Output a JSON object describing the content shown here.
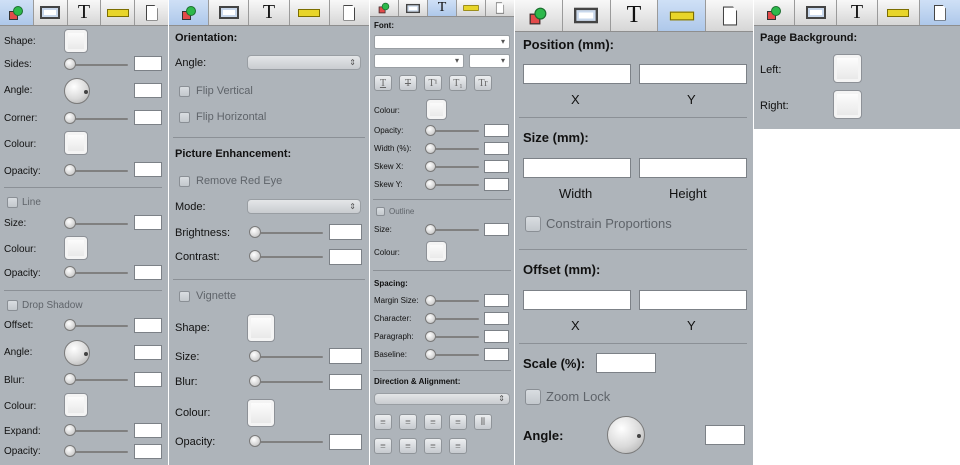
{
  "p1": {
    "tabs": [
      "",
      "",
      "T",
      "",
      ""
    ],
    "shape_label": "Shape:",
    "sides_label": "Sides:",
    "angle_label": "Angle:",
    "corner_label": "Corner:",
    "colour_label": "Colour:",
    "opacity_label": "Opacity:",
    "line_label": "Line",
    "line_size_label": "Size:",
    "line_colour_label": "Colour:",
    "line_opacity_label": "Opacity:",
    "shadow_label": "Drop Shadow",
    "shadow_offset_label": "Offset:",
    "shadow_angle_label": "Angle:",
    "shadow_blur_label": "Blur:",
    "shadow_colour_label": "Colour:",
    "shadow_expand_label": "Expand:",
    "shadow_opacity_label": "Opacity:"
  },
  "p2": {
    "tabs": [
      "",
      "",
      "T",
      "",
      ""
    ],
    "orientation_heading": "Orientation:",
    "angle_label": "Angle:",
    "flip_vertical": "Flip Vertical",
    "flip_horizontal": "Flip Horizontal",
    "enhancement_heading": "Picture Enhancement:",
    "remove_red_eye": "Remove Red Eye",
    "mode_label": "Mode:",
    "brightness_label": "Brightness:",
    "contrast_label": "Contrast:",
    "vignette_label": "Vignette",
    "shape_label": "Shape:",
    "size_label": "Size:",
    "blur_label": "Blur:",
    "colour_label": "Colour:",
    "opacity_label": "Opacity:"
  },
  "p3": {
    "tabs": [
      "",
      "",
      "T",
      "",
      ""
    ],
    "font_heading": "Font:",
    "colour_label": "Colour:",
    "opacity_label": "Opacity:",
    "width_label": "Width (%):",
    "skewx_label": "Skew X:",
    "skewy_label": "Skew Y:",
    "outline_label": "Outline",
    "outline_size_label": "Size:",
    "outline_colour_label": "Colour:",
    "spacing_heading": "Spacing:",
    "margin_label": "Margin Size:",
    "character_label": "Character:",
    "paragraph_label": "Paragraph:",
    "baseline_label": "Baseline:",
    "direction_heading": "Direction & Alignment:",
    "style_buttons": [
      "T",
      "T",
      "T¹",
      "T₁",
      "Tr"
    ]
  },
  "p4": {
    "tabs": [
      "",
      "",
      "T",
      "",
      ""
    ],
    "position_heading": "Position (mm):",
    "pos_x": "X",
    "pos_y": "Y",
    "size_heading": "Size (mm):",
    "width_label": "Width",
    "height_label": "Height",
    "constrain_label": "Constrain Proportions",
    "offset_heading": "Offset (mm):",
    "off_x": "X",
    "off_y": "Y",
    "scale_label": "Scale (%):",
    "zoom_lock": "Zoom Lock",
    "angle_label": "Angle:"
  },
  "p5": {
    "tabs": [
      "",
      "",
      "T",
      "",
      ""
    ],
    "heading": "Page Background:",
    "left_label": "Left:",
    "right_label": "Right:"
  },
  "icons": {
    "tab1": "shape-icon",
    "tab2": "frame-icon",
    "tab3": "text-icon",
    "tab4": "ruler-icon",
    "tab5": "page-icon"
  }
}
